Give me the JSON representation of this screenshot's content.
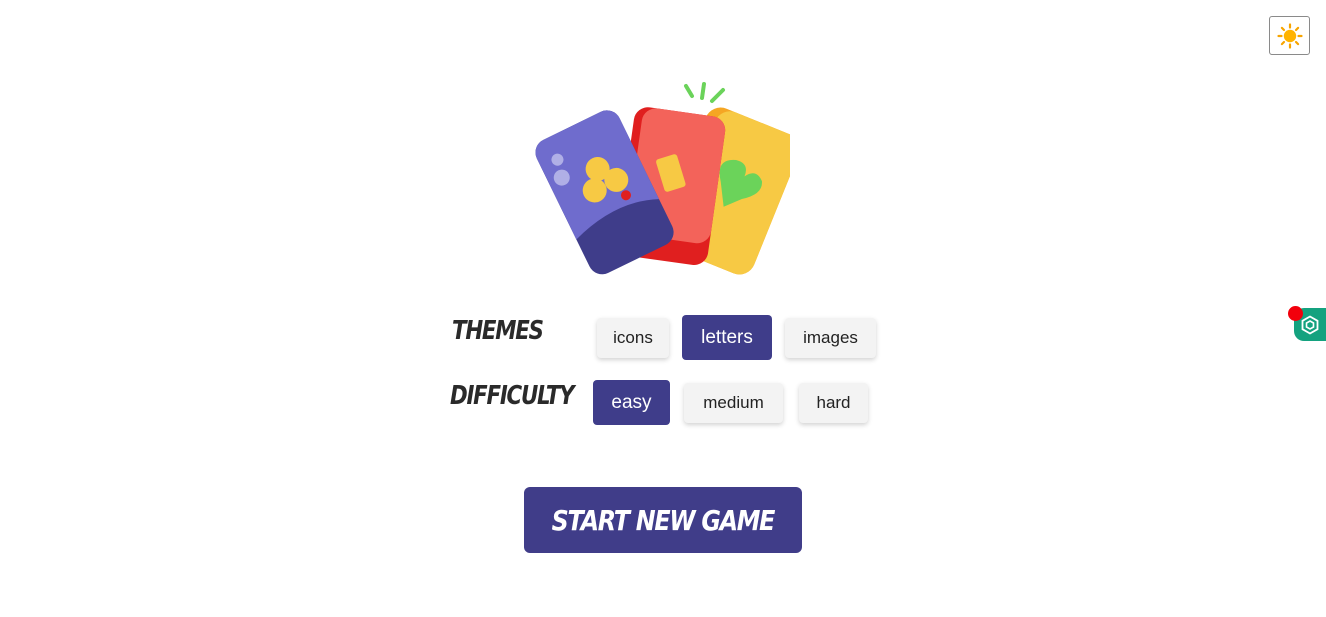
{
  "header": {
    "theme_toggle_icon": "sun-icon"
  },
  "themes": {
    "label": "THEMES",
    "options": [
      "icons",
      "letters",
      "images"
    ],
    "selected": "letters"
  },
  "difficulty": {
    "label": "DIFFICULTY",
    "options": [
      "easy",
      "medium",
      "hard"
    ],
    "selected": "easy"
  },
  "start_button": {
    "label": "START NEW GAME"
  },
  "side_widget": {
    "icon": "hexagon-icon"
  },
  "colors": {
    "accent": "#403d89",
    "option_bg": "#f3f3f3",
    "widget": "#14a27f",
    "notification": "#f2000c"
  }
}
